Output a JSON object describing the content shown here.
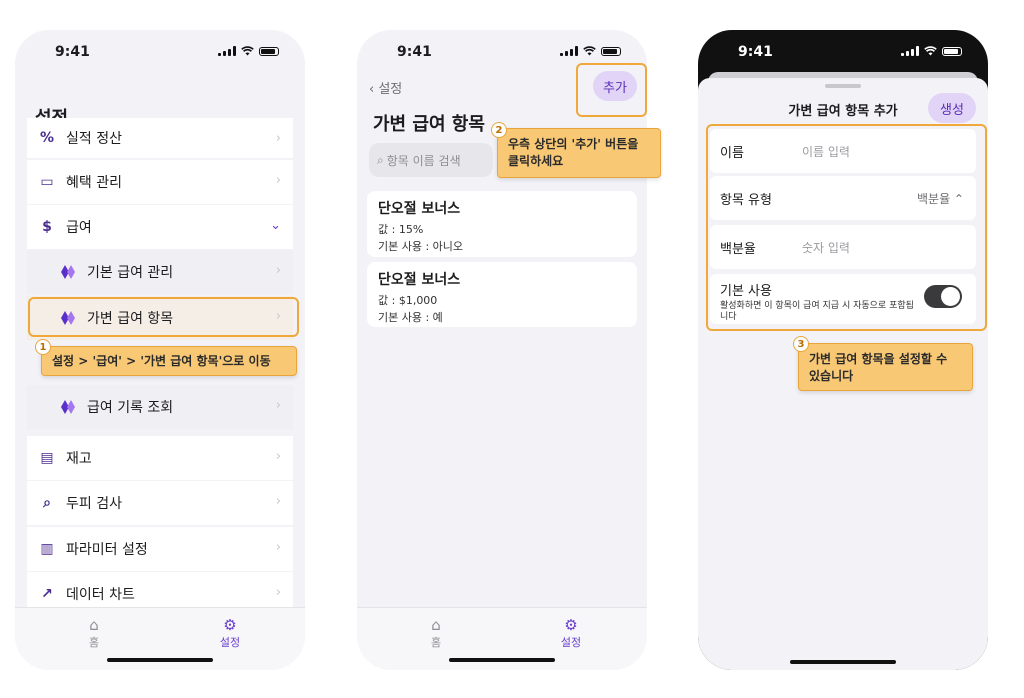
{
  "status": {
    "time": "9:41"
  },
  "phone1": {
    "title": "설정",
    "rows": [
      {
        "icon": "%",
        "label": "실적 정산"
      },
      {
        "icon": "▭",
        "label": "혜택 관리"
      },
      {
        "icon": "$",
        "label": "급여"
      },
      {
        "label": "기본 급여 관리"
      },
      {
        "label": "가변 급여 항목"
      },
      {
        "label": "급여 기록 조회"
      },
      {
        "icon": "▤",
        "label": "재고"
      },
      {
        "icon": "⌕",
        "label": "두피 검사"
      },
      {
        "icon": "▥",
        "label": "파라미터 설정"
      },
      {
        "icon": "↗",
        "label": "데이터 차트"
      }
    ],
    "callout_num": "1",
    "callout": "설정 > '급여' > '가변 급여 항목'으로 이동"
  },
  "phone2": {
    "back": "설정",
    "add": "추가",
    "title": "가변 급여 항목",
    "search_placeholder": "항목 이름 검색",
    "callout_num": "2",
    "callout_line1": "우측 상단의 '추가' 버튼을",
    "callout_line2": "클릭하세요",
    "cards": [
      {
        "name": "단오절 보너스",
        "value": "값 : 15%",
        "default": "기본 사용 : 아니오"
      },
      {
        "name": "단오절 보너스",
        "value": "값 : $1,000",
        "default": "기본 사용 : 예"
      }
    ]
  },
  "tabs": {
    "home": "홈",
    "settings": "설정"
  },
  "phone3": {
    "title": "가변 급여 항목 추가",
    "create": "생성",
    "name_label": "이름",
    "name_placeholder": "이름 입력",
    "type_label": "항목 유형",
    "type_value": "백분율 ⌃",
    "percent_label": "백분율",
    "percent_placeholder": "숫자 입력",
    "default_label": "기본 사용",
    "default_desc": "활성화하면 이 항목이 급여 지급 시 자동으로 포함됩니다",
    "callout_num": "3",
    "callout_line1": "가변 급여 항목을 설정할 수",
    "callout_line2": "있습니다"
  }
}
